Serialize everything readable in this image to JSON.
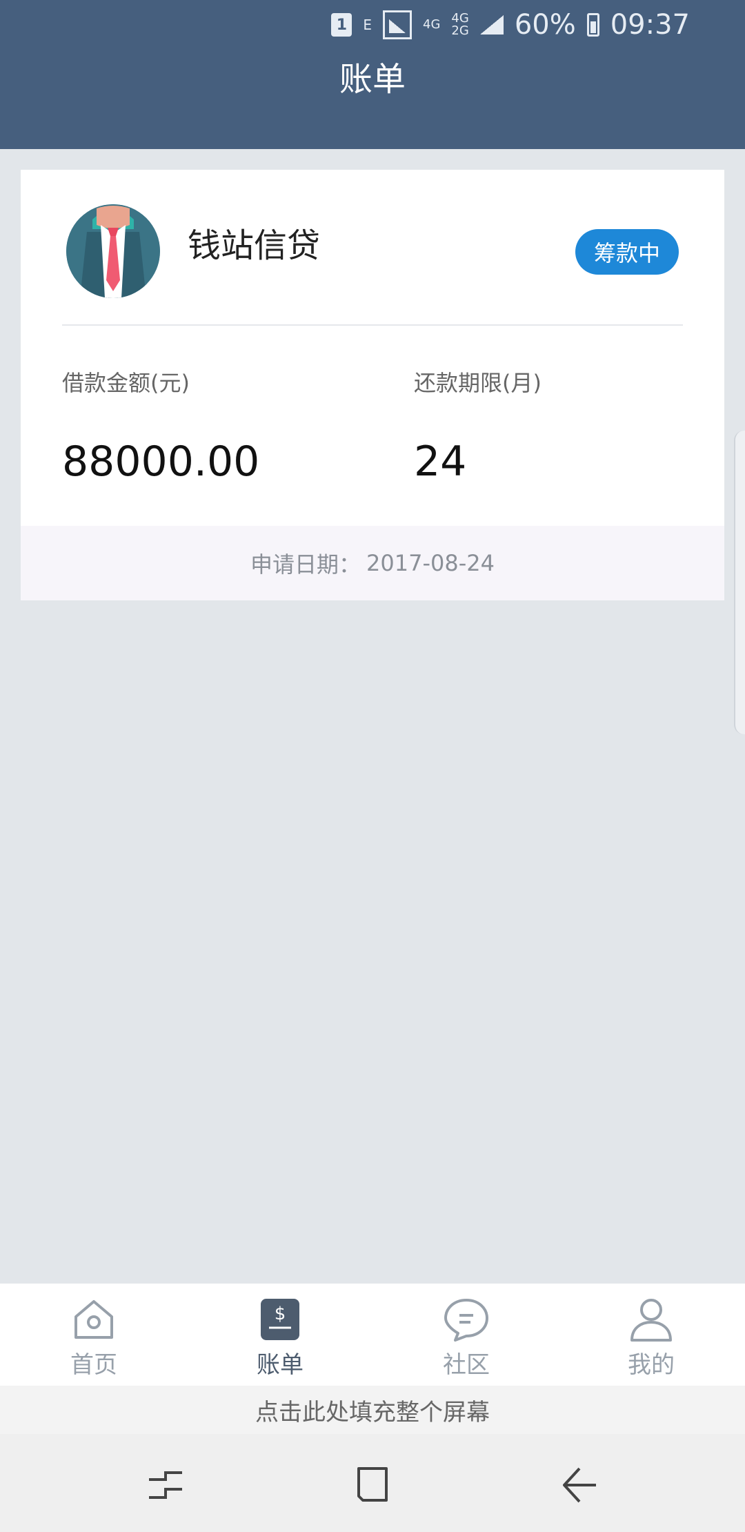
{
  "status_bar": {
    "sim": "1",
    "e_label": "E",
    "net1": "4G",
    "net2a": "4G",
    "net2b": "2G",
    "battery": "60%",
    "time": "09:37"
  },
  "header": {
    "title": "账单"
  },
  "loan": {
    "org_name": "钱站信贷",
    "status": "筹款中",
    "amount_label": "借款金额(元)",
    "amount_value": "88000.00",
    "term_label": "还款期限(月)",
    "term_value": "24",
    "apply_date_label": "申请日期：",
    "apply_date": "2017-08-24"
  },
  "tabs": [
    {
      "label": "首页",
      "icon": "home-icon"
    },
    {
      "label": "账单",
      "icon": "bill-icon"
    },
    {
      "label": "社区",
      "icon": "chat-icon"
    },
    {
      "label": "我的",
      "icon": "user-icon"
    }
  ],
  "fill_screen_text": "点击此处填充整个屏幕",
  "colors": {
    "header": "#465f7e",
    "badge": "#1e88d8",
    "background": "#e2e6ea"
  }
}
